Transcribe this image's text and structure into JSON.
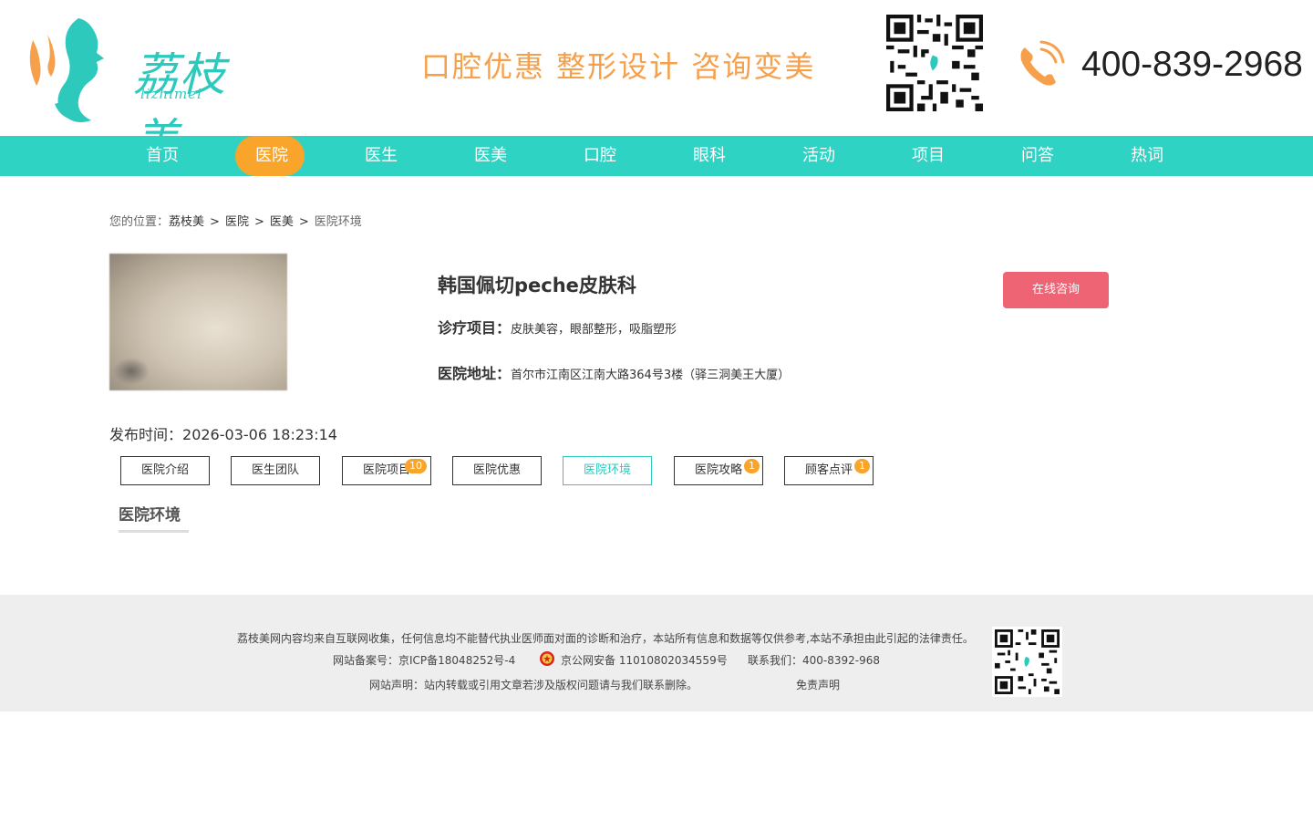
{
  "header": {
    "logo_text": "荔枝美",
    "logo_sub": "lizhimei",
    "slogan": "口腔优惠  整形设计  咨询变美",
    "phone": "400-839-2968"
  },
  "nav": {
    "items": [
      "首页",
      "医院",
      "医生",
      "医美",
      "口腔",
      "眼科",
      "活动",
      "项目",
      "问答",
      "热词"
    ],
    "active": "医院"
  },
  "breadcrumb": {
    "prefix": "您的位置：",
    "items": [
      "荔枝美",
      "医院",
      "医美",
      "医院环境"
    ],
    "separator": ">"
  },
  "hospital": {
    "name": "韩国佩切peche皮肤科",
    "services_label": "诊疗项目：",
    "services": "皮肤美容，眼部整形，吸脂塑形",
    "address_label": "医院地址：",
    "address": "首尔市江南区江南大路364号3楼（驿三洞美王大厦）",
    "consult_button": "在线咨询",
    "publish_label": "发布时间：",
    "publish_time": "2026-03-06 18:23:14"
  },
  "tabs": [
    {
      "label": "医院介绍",
      "badge": ""
    },
    {
      "label": "医生团队",
      "badge": ""
    },
    {
      "label": "医院项目",
      "badge": "10"
    },
    {
      "label": "医院优惠",
      "badge": ""
    },
    {
      "label": "医院环境",
      "badge": "",
      "active": true
    },
    {
      "label": "医院攻略",
      "badge": "1"
    },
    {
      "label": "顾客点评",
      "badge": "1"
    }
  ],
  "section_title": "医院环境",
  "footer": {
    "disclaimer": "荔枝美网内容均来自互联网收集，任何信息均不能替代执业医师面对面的诊断和治疗，本站所有信息和数据等仅供参考,本站不承担由此引起的法律责任。",
    "icp": "网站备案号：京ICP备18048252号-4",
    "police": "京公网安备 11010802034559号",
    "contact": "联系我们：400-8392-968",
    "statement": "网站声明：站内转载或引用文章若涉及版权问题请与我们联系删除。",
    "exemption": "免责声明"
  },
  "colors": {
    "teal": "#2ed3c4",
    "orange": "#f9a52b",
    "pink_button": "#ee6474"
  }
}
